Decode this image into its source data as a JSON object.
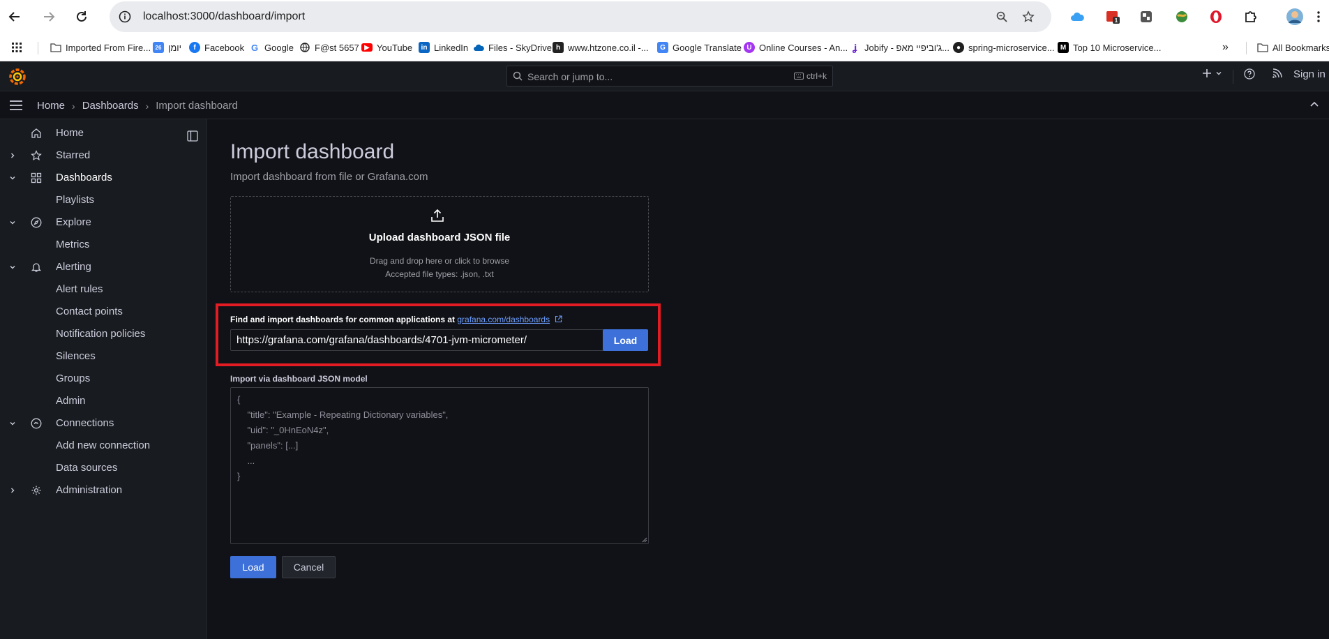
{
  "browser": {
    "url": "localhost:3000/dashboard/import",
    "bookmarks": [
      {
        "label": "Imported From Fire...",
        "icon": "folder-icon"
      },
      {
        "label": "יומן",
        "icon": "calendar-icon"
      },
      {
        "label": "Facebook",
        "icon": "facebook-icon"
      },
      {
        "label": "Google",
        "icon": "google-icon"
      },
      {
        "label": "F@st 5657",
        "icon": "globe-icon"
      },
      {
        "label": "YouTube",
        "icon": "youtube-icon"
      },
      {
        "label": "LinkedIn",
        "icon": "linkedin-icon"
      },
      {
        "label": "Files - SkyDrive",
        "icon": "onedrive-icon"
      },
      {
        "label": "www.htzone.co.il -...",
        "icon": "htzone-icon"
      },
      {
        "label": "Google Translate",
        "icon": "translate-icon"
      },
      {
        "label": "Online Courses - An...",
        "icon": "udemy-icon"
      },
      {
        "label": "Jobify - ג'וביפיי מאפ...",
        "icon": "jobify-icon"
      },
      {
        "label": "spring-microservice...",
        "icon": "github-icon"
      },
      {
        "label": "Top 10 Microservice...",
        "icon": "medium-icon"
      }
    ],
    "all_bookmarks": "All Bookmarks",
    "extension_badge": "1"
  },
  "topbar": {
    "search_placeholder": "Search or jump to...",
    "shortcut": "ctrl+k",
    "sign_in": "Sign in"
  },
  "breadcrumb": {
    "home": "Home",
    "dashboards": "Dashboards",
    "current": "Import dashboard"
  },
  "sidebar": {
    "items": [
      {
        "label": "Home",
        "icon": "home-icon",
        "chevron": "",
        "level": 0
      },
      {
        "label": "Starred",
        "icon": "star-icon",
        "chevron": "right",
        "level": 0
      },
      {
        "label": "Dashboards",
        "icon": "dashboards-icon",
        "chevron": "down",
        "level": 0,
        "active": true
      },
      {
        "label": "Playlists",
        "icon": "",
        "chevron": "",
        "level": 1
      },
      {
        "label": "Explore",
        "icon": "compass-icon",
        "chevron": "down",
        "level": 0
      },
      {
        "label": "Metrics",
        "icon": "",
        "chevron": "",
        "level": 1
      },
      {
        "label": "Alerting",
        "icon": "bell-icon",
        "chevron": "down",
        "level": 0
      },
      {
        "label": "Alert rules",
        "icon": "",
        "chevron": "",
        "level": 1
      },
      {
        "label": "Contact points",
        "icon": "",
        "chevron": "",
        "level": 1
      },
      {
        "label": "Notification policies",
        "icon": "",
        "chevron": "",
        "level": 1
      },
      {
        "label": "Silences",
        "icon": "",
        "chevron": "",
        "level": 1
      },
      {
        "label": "Groups",
        "icon": "",
        "chevron": "",
        "level": 1
      },
      {
        "label": "Admin",
        "icon": "",
        "chevron": "",
        "level": 1
      },
      {
        "label": "Connections",
        "icon": "connections-icon",
        "chevron": "down",
        "level": 0
      },
      {
        "label": "Add new connection",
        "icon": "",
        "chevron": "",
        "level": 1
      },
      {
        "label": "Data sources",
        "icon": "",
        "chevron": "",
        "level": 1
      },
      {
        "label": "Administration",
        "icon": "gear-icon",
        "chevron": "right",
        "level": 0
      }
    ]
  },
  "page": {
    "title": "Import dashboard",
    "subtitle": "Import dashboard from file or Grafana.com",
    "upload": {
      "title": "Upload dashboard JSON file",
      "help": "Drag and drop here or click to browse",
      "types": "Accepted file types: .json, .txt"
    },
    "grafana_com": {
      "label": "Find and import dashboards for common applications at ",
      "link": "grafana.com/dashboards",
      "value": "https://grafana.com/grafana/dashboards/4701-jvm-micrometer/",
      "load": "Load"
    },
    "json_model": {
      "label": "Import via dashboard JSON model",
      "placeholder": "{\n    \"title\": \"Example - Repeating Dictionary variables\",\n    \"uid\": \"_0HnEoN4z\",\n    \"panels\": [...]\n    ...\n}"
    },
    "buttons": {
      "load": "Load",
      "cancel": "Cancel"
    }
  },
  "colors": {
    "accent": "#3d71d9",
    "highlight": "#e31b23",
    "link": "#6e9fff",
    "grafana_orange": "#f46800"
  }
}
